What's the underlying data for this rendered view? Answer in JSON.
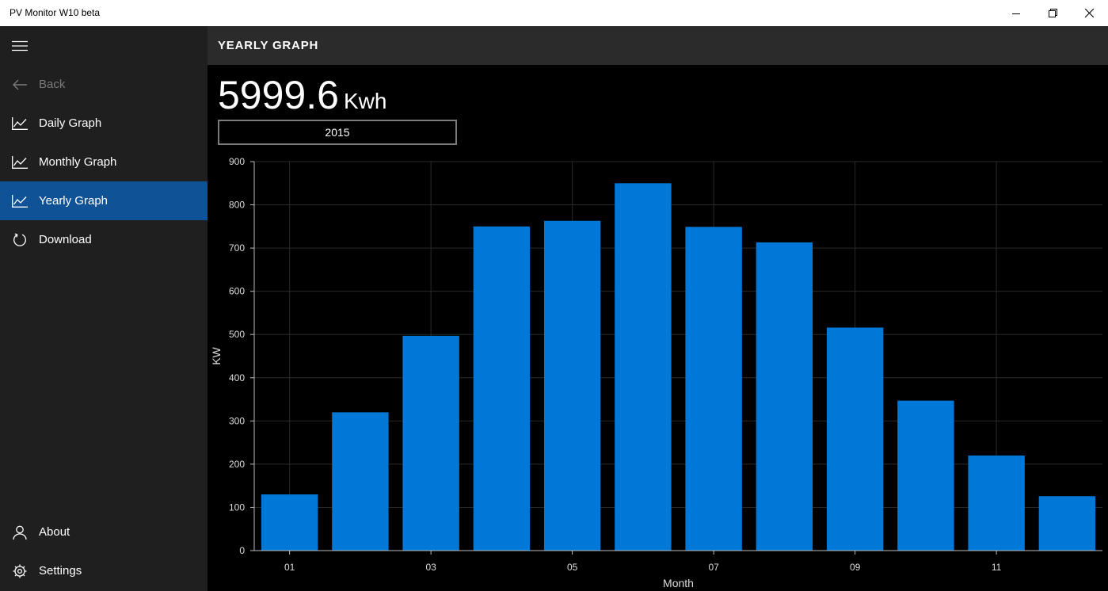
{
  "window": {
    "title": "PV Monitor W10 beta"
  },
  "nav": {
    "back_label": "Back",
    "items": [
      {
        "label": "Daily Graph",
        "icon": "line-chart-icon"
      },
      {
        "label": "Monthly Graph",
        "icon": "line-chart-icon"
      },
      {
        "label": "Yearly Graph",
        "icon": "line-chart-icon"
      },
      {
        "label": "Download",
        "icon": "refresh-icon"
      }
    ],
    "about_label": "About",
    "settings_label": "Settings",
    "selected": "Yearly Graph"
  },
  "header": {
    "title": "YEARLY GRAPH"
  },
  "total": {
    "value": "5999.6",
    "unit": "Kwh"
  },
  "year_selector": {
    "value": "2015"
  },
  "colors": {
    "accent": "#0f5396",
    "bar": "#0078d7",
    "sidebar": "#1f1f1f",
    "header": "#2b2b2b"
  },
  "chart_data": {
    "type": "bar",
    "xlabel": "Month",
    "ylabel": "KW",
    "categories": [
      "01",
      "02",
      "03",
      "04",
      "05",
      "06",
      "07",
      "08",
      "09",
      "10",
      "11",
      "12"
    ],
    "tick_labels": [
      "01",
      "03",
      "05",
      "07",
      "09",
      "11"
    ],
    "values": [
      130,
      320,
      497,
      750,
      763,
      850,
      749,
      713,
      516,
      347,
      220,
      126
    ],
    "ylim": [
      0,
      900
    ],
    "yticks": [
      0,
      100,
      200,
      300,
      400,
      500,
      600,
      700,
      800,
      900
    ],
    "grid": true
  }
}
